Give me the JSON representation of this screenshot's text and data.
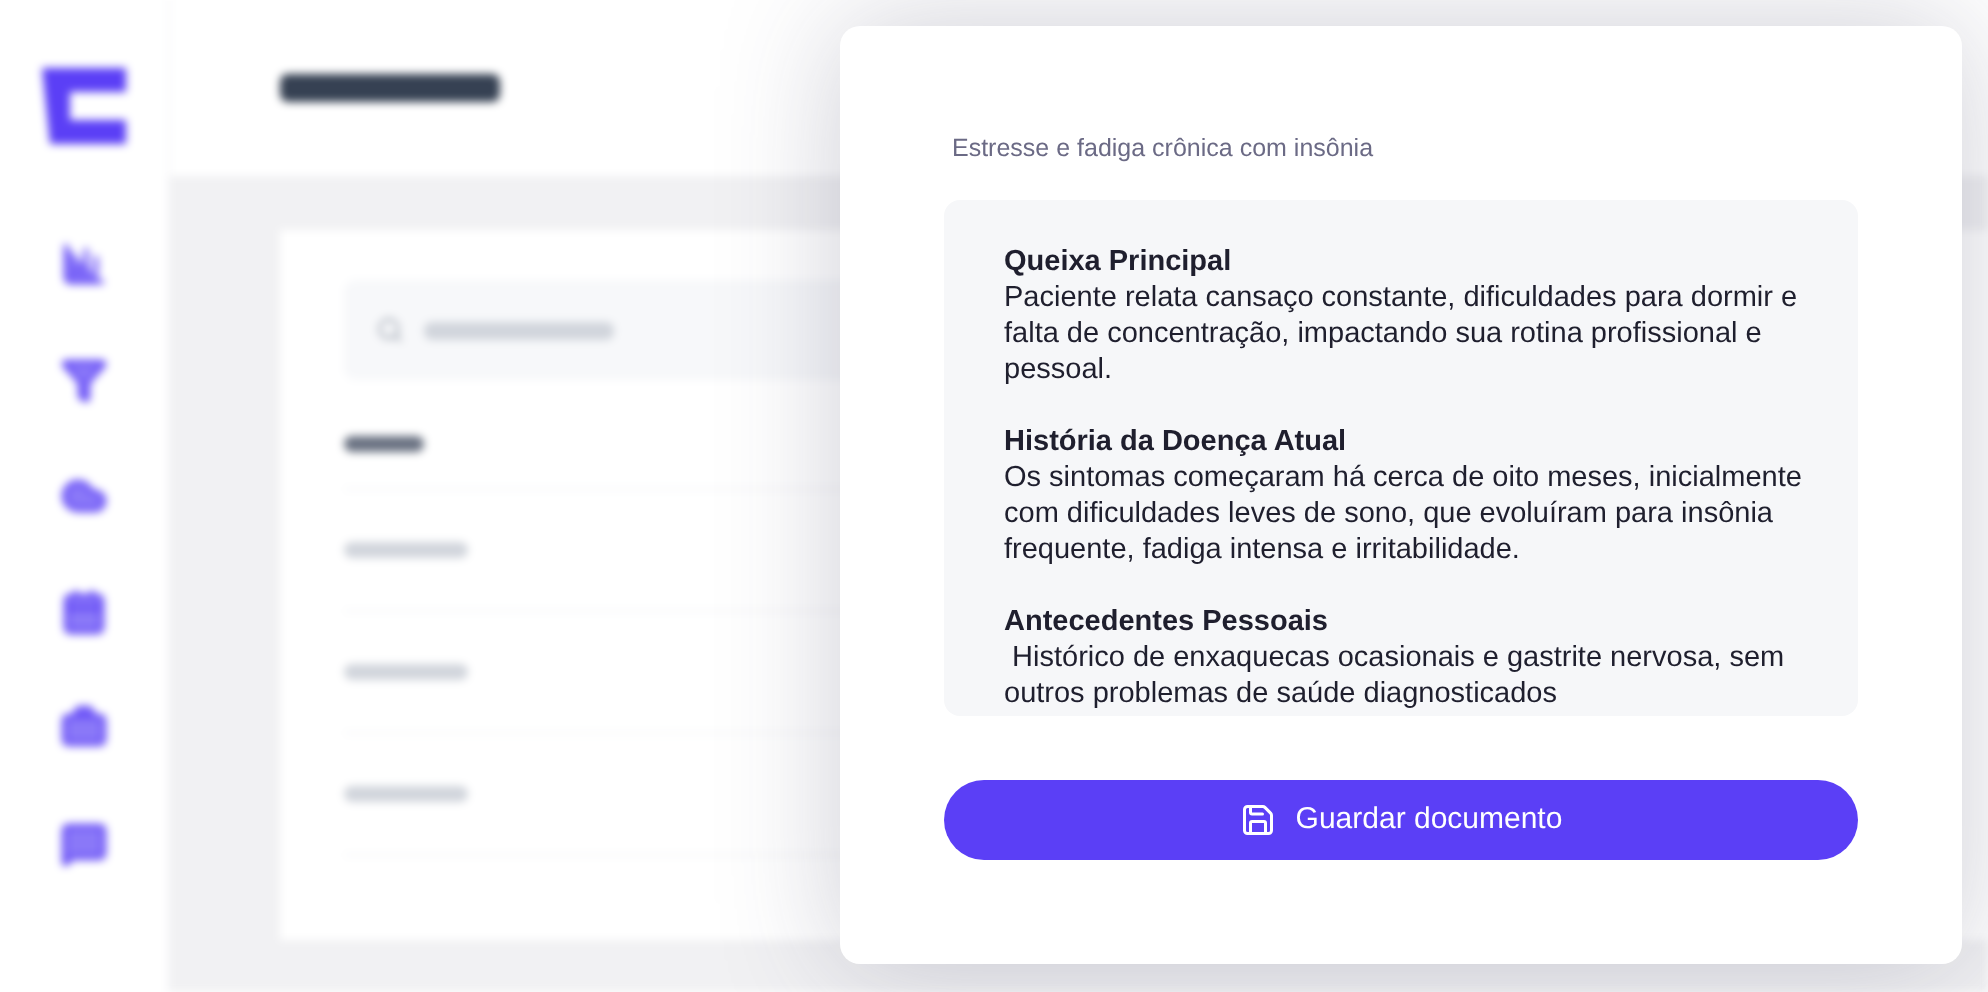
{
  "modal": {
    "subtitle": "Estresse e fadiga crônica com insônia",
    "sections": [
      {
        "heading": "Queixa Principal",
        "body": "Paciente relata cansaço constante, dificuldades para dormir e falta de concentração, impactando sua rotina profissional e pessoal."
      },
      {
        "heading": "História da Doença Atual",
        "body": "Os sintomas começaram há cerca de oito meses, inicialmente com dificuldades leves de sono, que evoluíram para insônia frequente, fadiga intensa e irritabilidade."
      },
      {
        "heading": "Antecedentes Pessoais",
        "body": " Histórico de enxaquecas ocasionais e gastrite nervosa, sem outros problemas de saúde diagnosticados"
      }
    ],
    "button": "Guardar documento"
  }
}
